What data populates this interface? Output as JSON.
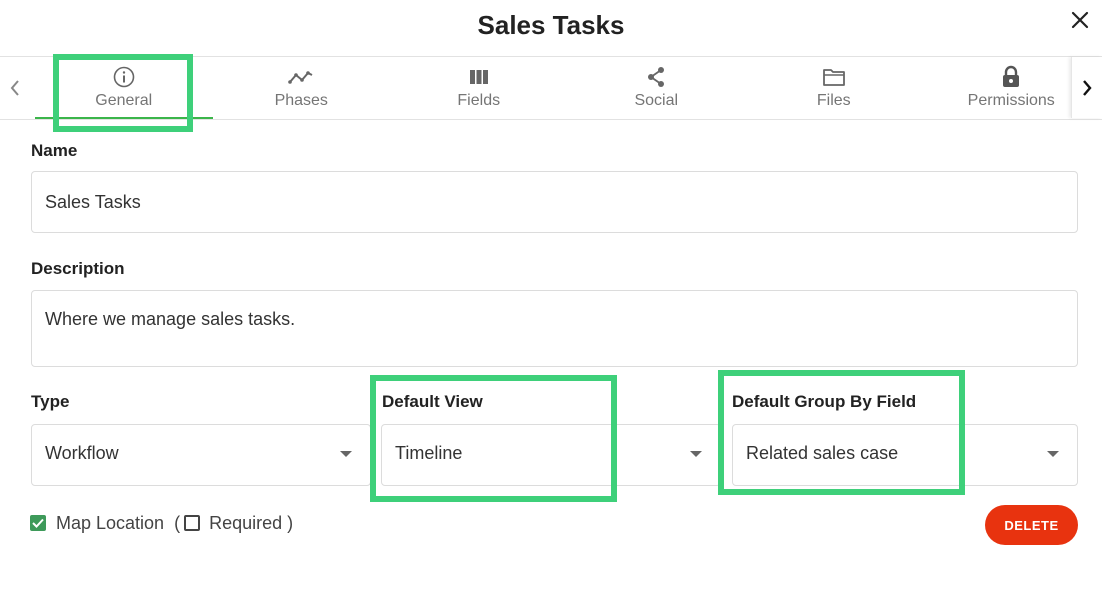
{
  "dialog": {
    "title": "Sales Tasks",
    "close_icon": "close-icon"
  },
  "tabs": [
    {
      "label": "General",
      "icon": "info-circle-icon",
      "active": true
    },
    {
      "label": "Phases",
      "icon": "line-chart-icon"
    },
    {
      "label": "Fields",
      "icon": "columns-icon"
    },
    {
      "label": "Social",
      "icon": "share-icon"
    },
    {
      "label": "Files",
      "icon": "folder-icon"
    },
    {
      "label": "Permissions",
      "icon": "lock-icon"
    }
  ],
  "form": {
    "name_label": "Name",
    "name_value": "Sales Tasks",
    "description_label": "Description",
    "description_value": "Where we manage sales tasks.",
    "type_label": "Type",
    "type_value": "Workflow",
    "default_view_label": "Default View",
    "default_view_value": "Timeline",
    "group_by_label": "Default Group By Field",
    "group_by_value": "Related sales case",
    "map_location_label": "Map Location",
    "map_location_checked": true,
    "open_paren": "(",
    "required_label": "Required",
    "required_checked": false,
    "close_paren": ")"
  },
  "actions": {
    "delete_label": "DELETE"
  },
  "colors": {
    "accent_green": "#3bb54a",
    "highlight_green": "#3ed07a",
    "delete_red": "#e8330f",
    "checkbox_green": "#3e9a5a"
  }
}
